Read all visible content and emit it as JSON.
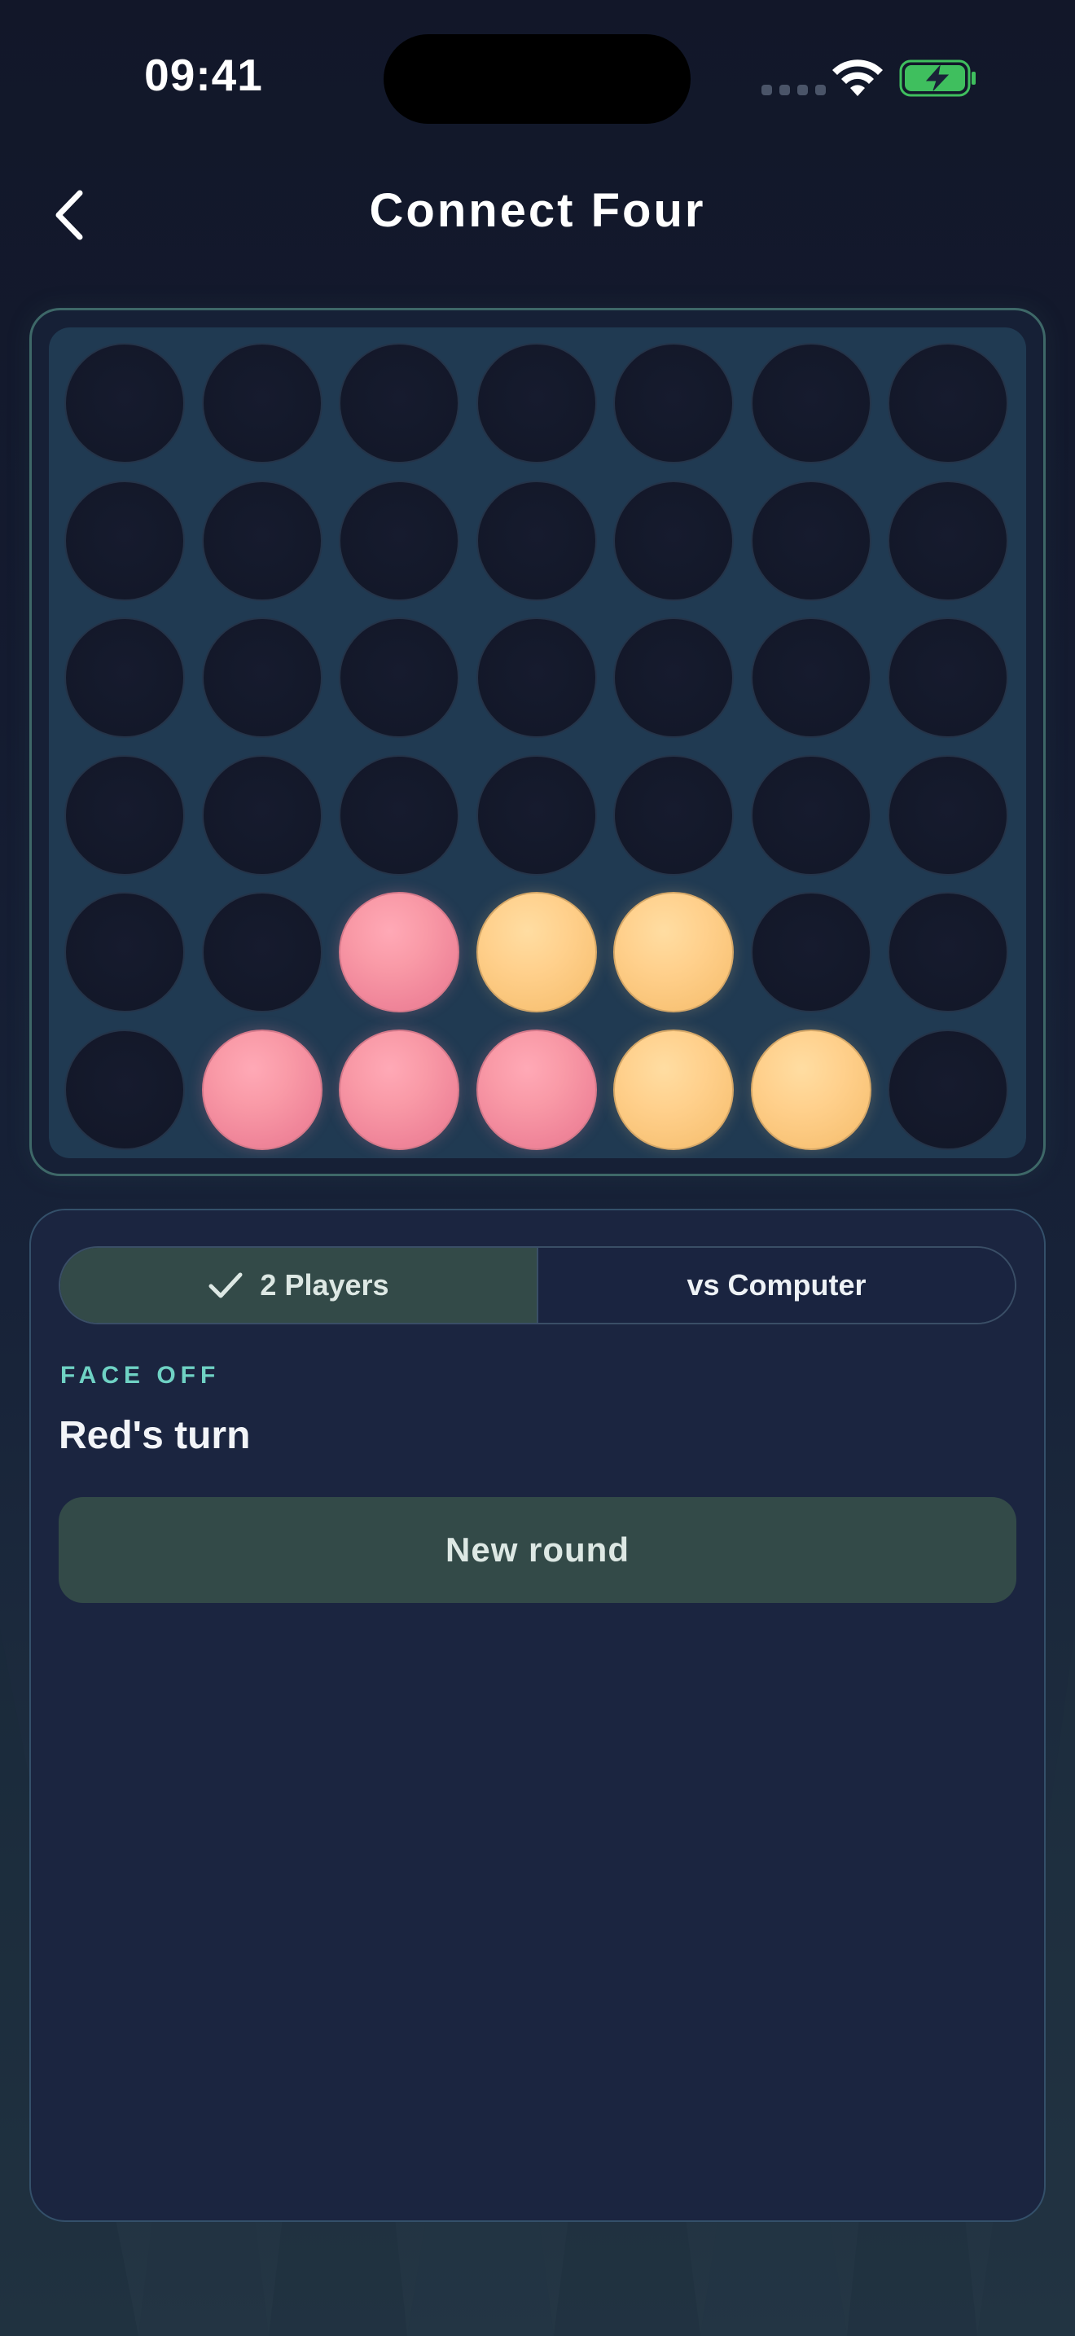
{
  "status_bar": {
    "time": "09:41"
  },
  "nav": {
    "title": "Connect Four",
    "back_icon": "chevron-left-icon"
  },
  "board": {
    "columns": 7,
    "rows": 6,
    "cells": [
      [
        "empty",
        "empty",
        "empty",
        "empty",
        "empty",
        "empty",
        "empty"
      ],
      [
        "empty",
        "empty",
        "empty",
        "empty",
        "empty",
        "empty",
        "empty"
      ],
      [
        "empty",
        "empty",
        "empty",
        "empty",
        "empty",
        "empty",
        "empty"
      ],
      [
        "empty",
        "empty",
        "empty",
        "empty",
        "empty",
        "empty",
        "empty"
      ],
      [
        "empty",
        "empty",
        "red",
        "yellow",
        "yellow",
        "empty",
        "empty"
      ],
      [
        "empty",
        "red",
        "red",
        "red",
        "yellow",
        "yellow",
        "empty"
      ]
    ],
    "colors": {
      "red": "#F99AA7",
      "yellow": "#FFD08C",
      "board": "#203A52",
      "empty": "#131829"
    }
  },
  "mode_selector": {
    "options": [
      {
        "label": "2 Players",
        "selected": true,
        "icon": "checkmark-icon"
      },
      {
        "label": "vs Computer",
        "selected": false
      }
    ]
  },
  "game_status": {
    "eyebrow": "FACE OFF",
    "turn_text": "Red's turn"
  },
  "actions": {
    "new_round_label": "New round"
  },
  "theme": {
    "accent": "#6FD2C4",
    "button_bg": "#334A48"
  }
}
